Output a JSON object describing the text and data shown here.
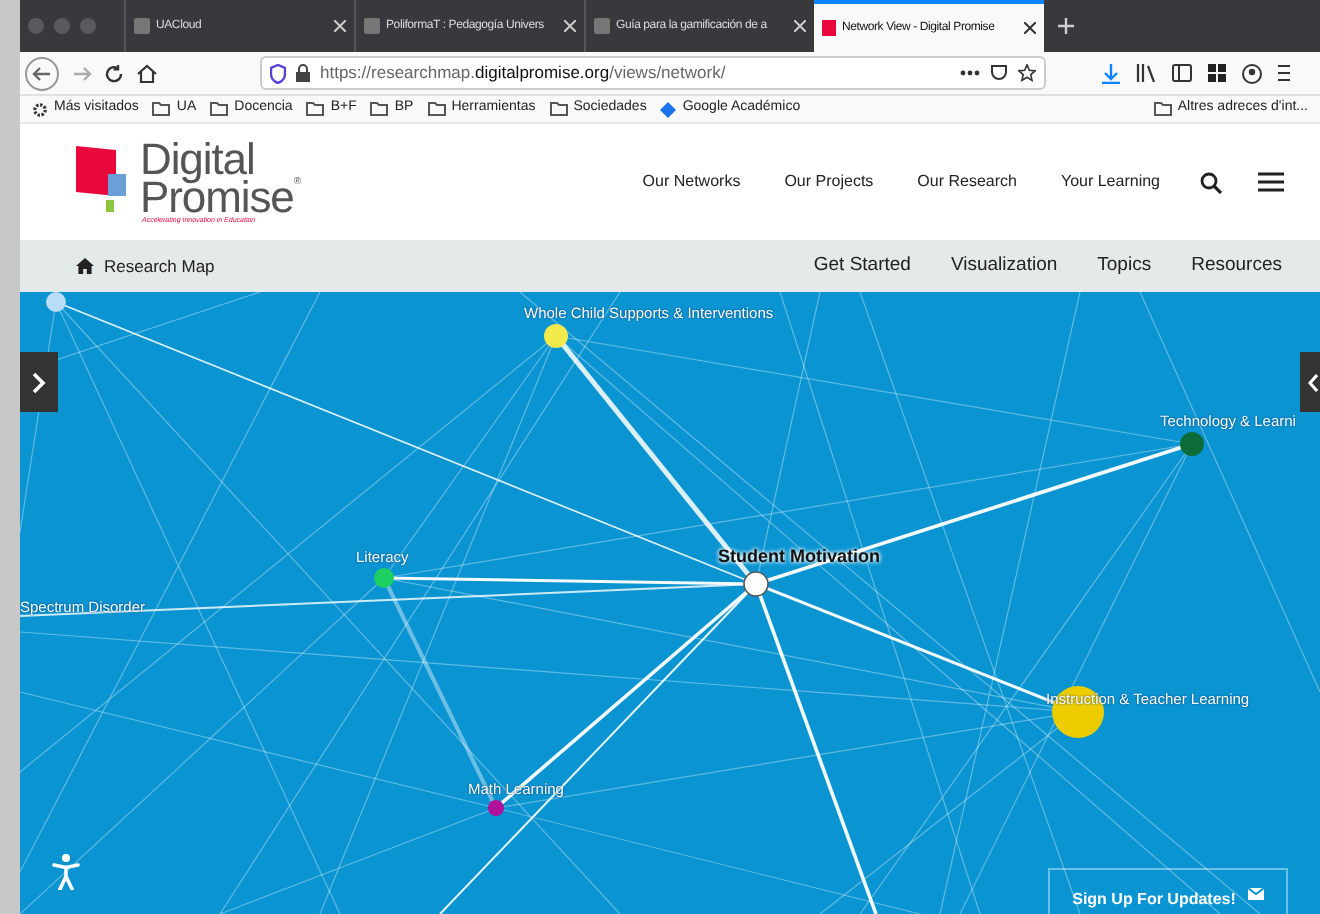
{
  "browser": {
    "tabs": [
      {
        "title": "UACloud",
        "selected": false
      },
      {
        "title": "PoliformaT : Pedagogía Univers",
        "selected": false
      },
      {
        "title": "Guía para la gamificación de a",
        "selected": false
      },
      {
        "title": "Network View - Digital Promise",
        "selected": true
      }
    ],
    "url_prefix": "https://researchmap.",
    "url_domain": "digitalpromise.org",
    "url_path": "/views/network/",
    "bookmarks": [
      "Más visitados",
      "UA",
      "Docencia",
      "B+F",
      "BP",
      "Herramientas",
      "Sociedades",
      "Google Académico"
    ],
    "other_bookmarks": "Altres adreces d'int..."
  },
  "site": {
    "logo_line1": "Digital",
    "logo_line2": "Promise",
    "logo_mark": "®",
    "tagline": "Accelerating Innovation in Education",
    "nav": [
      "Our Networks",
      "Our Projects",
      "Our Research",
      "Your Learning"
    ],
    "subnav_home": "Research Map",
    "subnav": [
      "Get Started",
      "Visualization",
      "Topics",
      "Resources"
    ]
  },
  "network": {
    "nodes": [
      {
        "color": "#b9dcf7"
      },
      {
        "label": "Whole Child Supports & Interventions",
        "color": "#f2e94b"
      },
      {
        "label": "Technology & Learni",
        "color": "#0d6b38"
      },
      {
        "label": "Literacy",
        "color": "#1ccf5e"
      },
      {
        "label": "Student Motivation",
        "color": "#ffffff"
      },
      {
        "label": "Spectrum Disorder"
      },
      {
        "label": "Instruction & Teacher Learning",
        "color": "#eecd00"
      },
      {
        "label": "Math Learning",
        "color": "#b0119a"
      }
    ],
    "signup": "Sign Up For Updates!"
  }
}
